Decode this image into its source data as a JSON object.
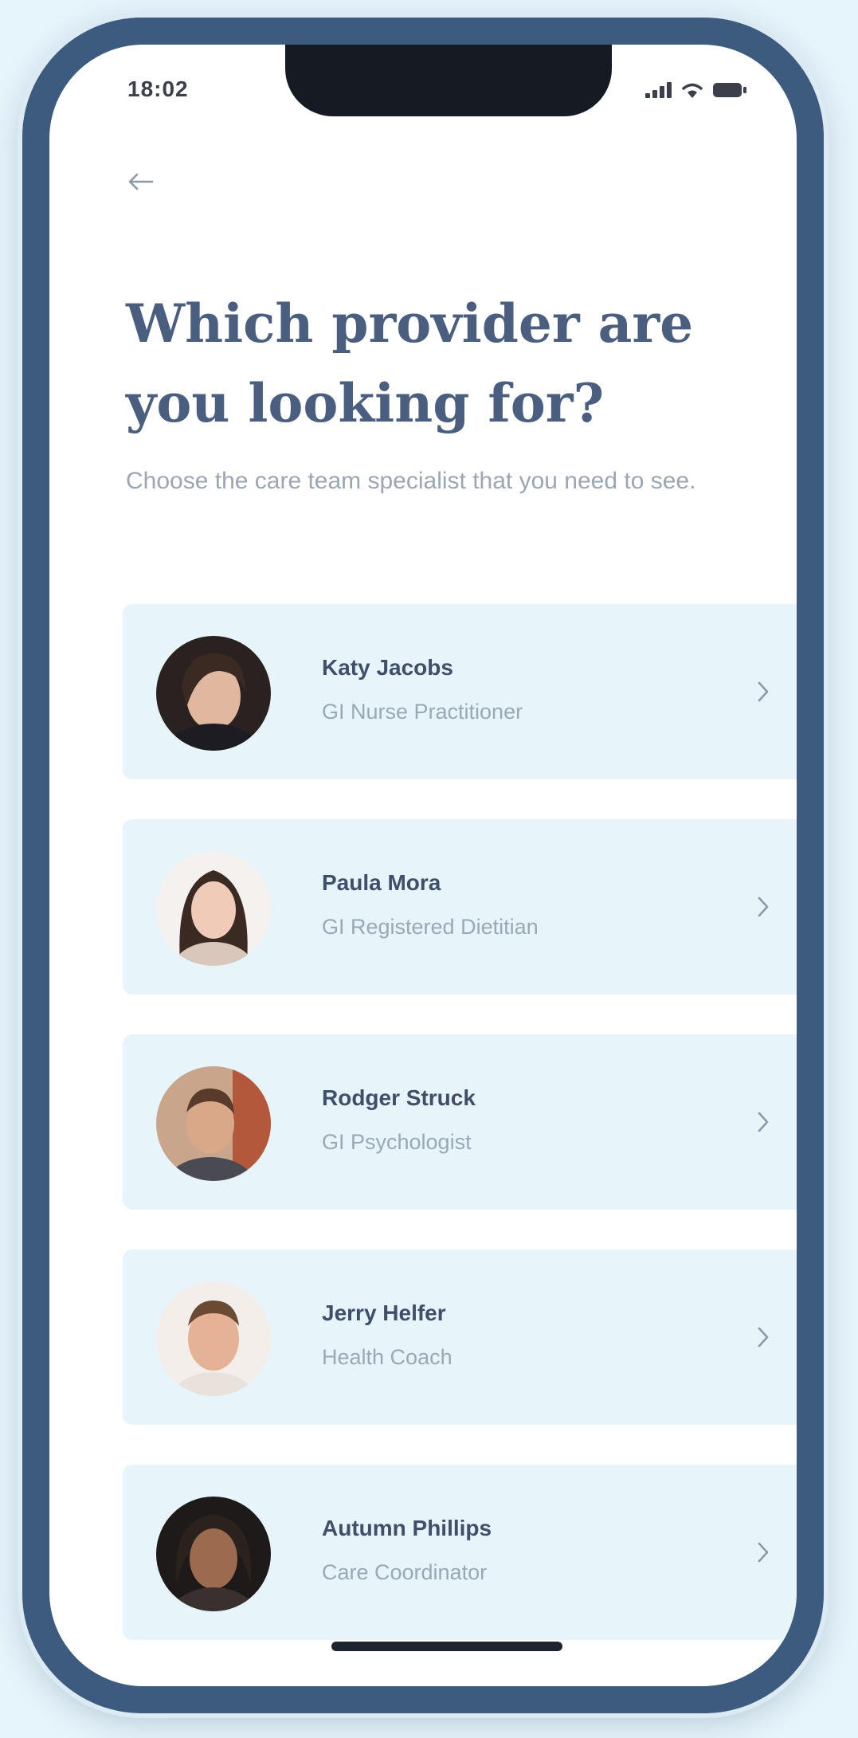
{
  "status_bar": {
    "time": "18:02",
    "icons": [
      "signal-icon",
      "wifi-icon",
      "battery-icon"
    ]
  },
  "nav": {
    "back_icon": "arrow-left-icon"
  },
  "header": {
    "title": "Which provider are you looking for?",
    "subtitle": "Choose the care team specialist that you need to see."
  },
  "providers": [
    {
      "name": "Katy Jacobs",
      "role": "GI Nurse Practitioner",
      "avatar": "avatar-1"
    },
    {
      "name": "Paula Mora",
      "role": "GI Registered Dietitian",
      "avatar": "avatar-2"
    },
    {
      "name": "Rodger Struck",
      "role": "GI Psychologist",
      "avatar": "avatar-3"
    },
    {
      "name": "Jerry Helfer",
      "role": "Health Coach",
      "avatar": "avatar-4"
    },
    {
      "name": "Autumn Phillips",
      "role": "Care Coordinator",
      "avatar": "avatar-5"
    }
  ],
  "colors": {
    "frame": "#3d5a7f",
    "title": "#4a5e80",
    "card_bg": "#e7f5fb",
    "muted_text": "#9aa8b6"
  }
}
